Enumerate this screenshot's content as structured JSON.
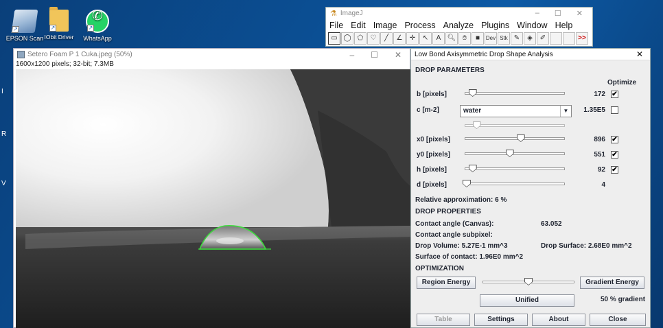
{
  "desktop": {
    "icons": [
      {
        "label": "EPSON Scan",
        "icon": "epson-scan-icon"
      },
      {
        "label": "IObit Driver Booster PR",
        "icon": "folder-icon"
      },
      {
        "label": "WhatsApp",
        "icon": "whatsapp-icon"
      }
    ],
    "edge_letters": [
      "I",
      "R",
      "V"
    ]
  },
  "imagej": {
    "title": "ImageJ",
    "menu": [
      "File",
      "Edit",
      "Image",
      "Process",
      "Analyze",
      "Plugins",
      "Window",
      "Help"
    ],
    "tools": [
      "rectangle-tool-icon",
      "oval-tool-icon",
      "polygon-tool-icon",
      "freehand-tool-icon",
      "line-tool-icon",
      "angle-tool-icon",
      "point-tool-icon",
      "wand-tool-icon",
      "text-tool-icon",
      "magnifier-tool-icon",
      "hand-tool-icon",
      "color-picker-icon",
      "dev-tool-icon",
      "stk-tool-icon",
      "brush-tool-icon",
      "flood-fill-icon",
      "pencil-tool-icon",
      "blank-tool-icon",
      "blank-tool-icon",
      "more-tools-icon"
    ],
    "dev_label": "Dev",
    "stk_label": "Stk",
    "more_label": ">>"
  },
  "image_window": {
    "title": "Setero Foam P 1 Cuka.jpeg (50%)",
    "info": "1600x1200 pixels; 32-bit; 7.3MB"
  },
  "dialog": {
    "title": "Low Bond Axisymmetric Drop Shape Analysis",
    "sections": {
      "params": "DROP PARAMETERS",
      "props": "DROP PROPERTIES",
      "opt": "OPTIMIZATION"
    },
    "optimize_label": "Optimize",
    "params": [
      {
        "label": "b [pixels]",
        "value": "172",
        "slider": 0.08,
        "checked": true
      },
      {
        "label": "c [m-2]",
        "value": "1.35E5",
        "checked": false,
        "combo": "water",
        "slider": 0.12
      },
      {
        "label": "x0 [pixels]",
        "value": "896",
        "slider": 0.56,
        "checked": true
      },
      {
        "label": "y0 [pixels]",
        "value": "551",
        "slider": 0.45,
        "checked": true
      },
      {
        "label": "h [pixels]",
        "value": "92",
        "slider": 0.08,
        "checked": true
      },
      {
        "label": "d [pixels]",
        "value": "4",
        "slider": 0.02
      }
    ],
    "relative_approx": "Relative approximation: 6 %",
    "properties": {
      "contact_angle_canvas_label": "Contact angle (Canvas):",
      "contact_angle_canvas_value": "63.052",
      "contact_angle_subpixel_label": "Contact angle subpixel:",
      "drop_volume": "Drop Volume: 5.27E-1 mm^3",
      "drop_surface": "Drop Surface: 2.68E0 mm^2",
      "surface_contact": "Surface of contact: 1.96E0 mm^2"
    },
    "optimization": {
      "region_energy": "Region Energy",
      "gradient_energy": "Gradient Energy",
      "unified": "Unified",
      "gradient_pct": "50 % gradient",
      "slider": 0.5
    },
    "buttons": {
      "table": "Table",
      "settings": "Settings",
      "about": "About",
      "close": "Close"
    }
  }
}
